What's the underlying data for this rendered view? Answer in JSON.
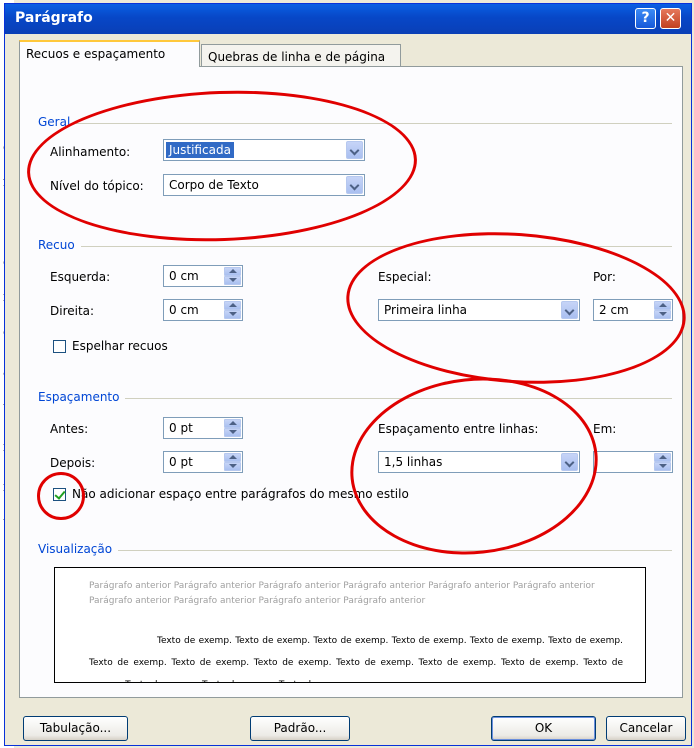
{
  "window": {
    "title": "Parágrafo",
    "help_label": "?",
    "close_label": "✕"
  },
  "tabs": [
    {
      "label": "Recuos e espaçamento",
      "active": true
    },
    {
      "label": "Quebras de linha e de página",
      "active": false
    }
  ],
  "geral": {
    "title": "Geral",
    "alignment_label": "Alinhamento:",
    "alignment_value": "Justificada",
    "outline_label": "Nível do tópico:",
    "outline_value": "Corpo de Texto"
  },
  "recuo": {
    "title": "Recuo",
    "left_label": "Esquerda:",
    "left_value": "0 cm",
    "right_label": "Direita:",
    "right_value": "0 cm",
    "special_label": "Especial:",
    "special_value": "Primeira linha",
    "by_label": "Por:",
    "by_value": "2 cm",
    "mirror_label": "Espelhar recuos",
    "mirror_checked": false
  },
  "espacamento": {
    "title": "Espaçamento",
    "before_label": "Antes:",
    "before_value": "0 pt",
    "after_label": "Depois:",
    "after_value": "0 pt",
    "line_spacing_label": "Espaçamento entre linhas:",
    "line_spacing_value": "1,5 linhas",
    "at_label": "Em:",
    "at_value": "",
    "no_space_label": "Não adicionar espaço entre parágrafos do mesmo estilo",
    "no_space_checked": true
  },
  "visualizacao": {
    "title": "Visualização",
    "previous_text": "Parágrafo anterior Parágrafo anterior Parágrafo anterior Parágrafo anterior Parágrafo anterior Parágrafo anterior Parágrafo anterior Parágrafo anterior Parágrafo anterior Parágrafo anterior",
    "sample_text": "Texto de exemp. Texto de exemp. Texto de exemp. Texto de exemp. Texto de exemp. Texto de exemp. Texto de exemp. Texto de exemp. Texto de exemp. Texto de exemp. Texto de exemp. Texto de exemp. Texto de exemp. Texto de exemp. Texto de exemp. Texto de exemp."
  },
  "buttons": {
    "tabs": "Tabulação...",
    "default": "Padrão...",
    "ok": "OK",
    "cancel": "Cancelar"
  },
  "colors": {
    "annotation": "#e00000",
    "title_bar": "#0a5fe3",
    "group_title": "#0046d5"
  }
}
